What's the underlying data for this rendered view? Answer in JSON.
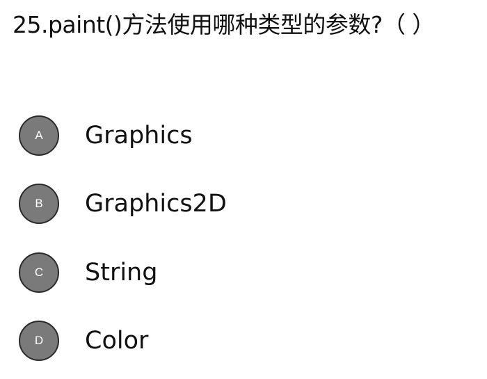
{
  "question": {
    "text": "25.paint()方法使用哪种类型的参数?（ ）"
  },
  "options": [
    {
      "letter": "A",
      "text": "Graphics"
    },
    {
      "letter": "B",
      "text": "Graphics2D"
    },
    {
      "letter": "C",
      "text": "String"
    },
    {
      "letter": "D",
      "text": "Color"
    }
  ]
}
